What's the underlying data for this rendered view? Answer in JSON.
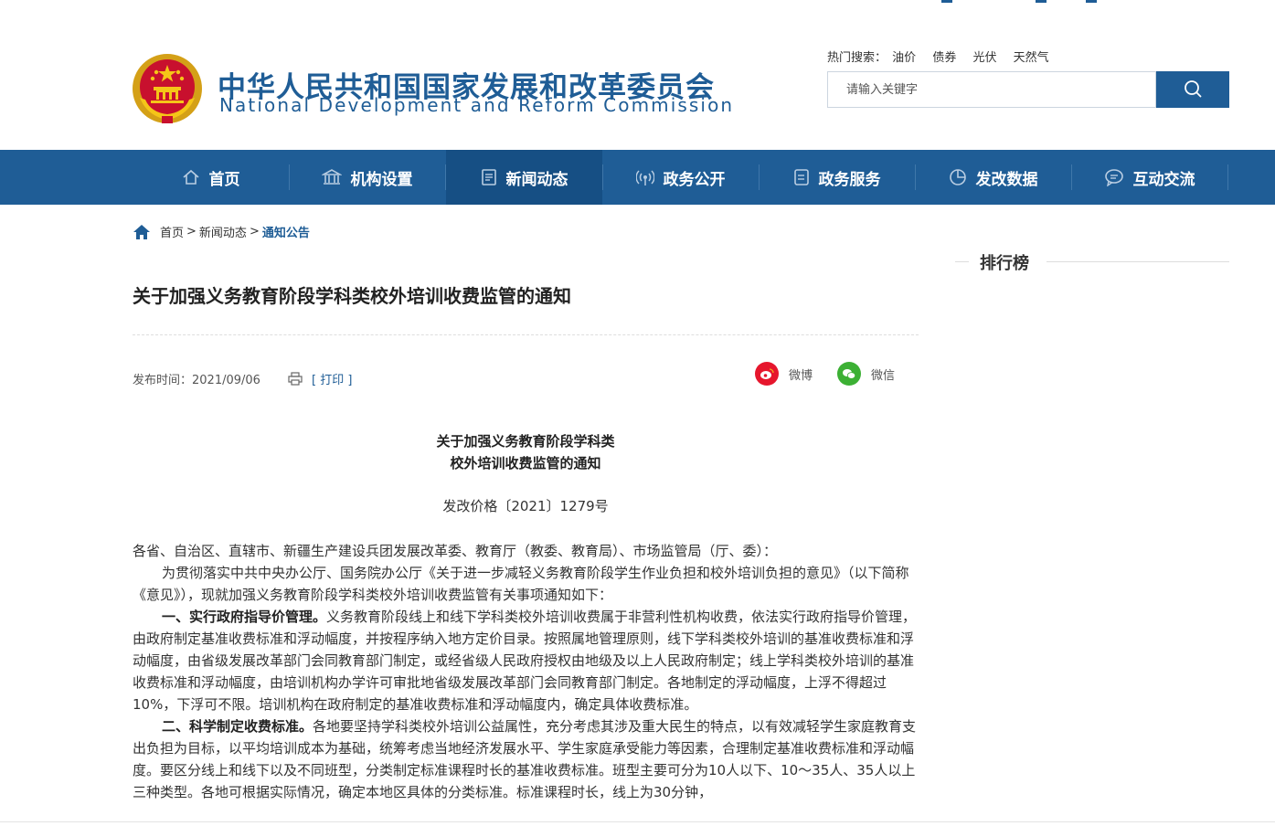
{
  "colors": {
    "brand": "#1f5d96",
    "nav_active": "#164f84",
    "weibo": "#e6162d",
    "wechat": "#3cb034"
  },
  "header": {
    "title_cn": "中华人民共和国国家发展和改革委员会",
    "title_en": "National Development and Reform Commission",
    "hot_label": "热门搜索：",
    "hot_keywords": [
      "油价",
      "债券",
      "光伏",
      "天然气"
    ],
    "search_placeholder": "请输入关键字"
  },
  "nav": [
    {
      "label": "首页",
      "icon": "home-icon"
    },
    {
      "label": "机构设置",
      "icon": "building-icon"
    },
    {
      "label": "新闻动态",
      "icon": "news-icon"
    },
    {
      "label": "政务公开",
      "icon": "broadcast-icon"
    },
    {
      "label": "政务服务",
      "icon": "document-icon"
    },
    {
      "label": "发改数据",
      "icon": "pie-chart-icon"
    },
    {
      "label": "互动交流",
      "icon": "chat-icon"
    }
  ],
  "breadcrumb": {
    "items": [
      "首页",
      "新闻动态",
      "通知公告"
    ],
    "sep": ">"
  },
  "article": {
    "title": "关于加强义务教育阶段学科类校外培训收费监管的通知",
    "date_label": "发布时间：",
    "date": "2021/09/06",
    "print_label": "[ 打印 ]",
    "share_weibo": "微博",
    "share_wechat": "微信",
    "doc_title_1": "关于加强义务教育阶段学科类",
    "doc_title_2": "校外培训收费监管的通知",
    "doc_number": "发改价格〔2021〕1279号",
    "addressee": "各省、自治区、直辖市、新疆生产建设兵团发展改革委、教育厅（教委、教育局）、市场监管局（厅、委）：",
    "intro": "为贯彻落实中共中央办公厅、国务院办公厅《关于进一步减轻义务教育阶段学生作业负担和校外培训负担的意见》（以下简称《意见》），现就加强义务教育阶段学科类校外培训收费监管有关事项通知如下：",
    "section1_head": "一、实行政府指导价管理。",
    "section1_body": "义务教育阶段线上和线下学科类校外培训收费属于非营利性机构收费，依法实行政府指导价管理，由政府制定基准收费标准和浮动幅度，并按程序纳入地方定价目录。按照属地管理原则，线下学科类校外培训的基准收费标准和浮动幅度，由省级发展改革部门会同教育部门制定，或经省级人民政府授权由地级及以上人民政府制定；线上学科类校外培训的基准收费标准和浮动幅度，由培训机构办学许可审批地省级发展改革部门会同教育部门制定。各地制定的浮动幅度，上浮不得超过10%，下浮可不限。培训机构在政府制定的基准收费标准和浮动幅度内，确定具体收费标准。",
    "section2_head": "二、科学制定收费标准。",
    "section2_body": "各地要坚持学科类校外培训公益属性，充分考虑其涉及重大民生的特点，以有效减轻学生家庭教育支出负担为目标，以平均培训成本为基础，统筹考虑当地经济发展水平、学生家庭承受能力等因素，合理制定基准收费标准和浮动幅度。要区分线上和线下以及不同班型，分类制定标准课程时长的基准收费标准。班型主要可分为10人以下、10～35人、35人以上三种类型。各地可根据实际情况，确定本地区具体的分类标准。标准课程时长，线上为30分钟，"
  },
  "sidebar": {
    "ranking_title": "排行榜"
  }
}
